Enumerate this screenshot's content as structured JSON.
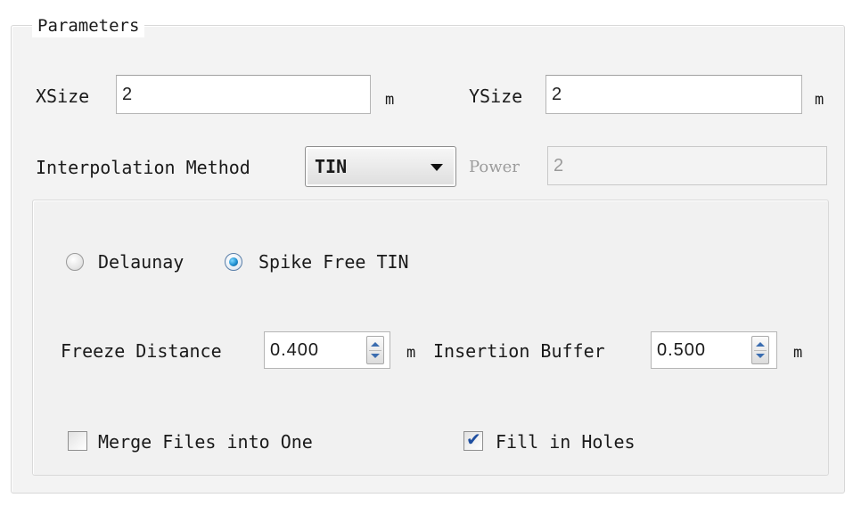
{
  "group": {
    "title": "Parameters"
  },
  "xsize": {
    "label": "XSize",
    "value": "2",
    "unit": "m"
  },
  "ysize": {
    "label": "YSize",
    "value": "2",
    "unit": "m"
  },
  "interpolation": {
    "label": "Interpolation Method",
    "selected": "TIN"
  },
  "power": {
    "label": "Power",
    "value": "2",
    "enabled": false
  },
  "tin_mode": {
    "options": [
      {
        "label": "Delaunay",
        "selected": false
      },
      {
        "label": "Spike Free TIN",
        "selected": true
      }
    ]
  },
  "freeze_distance": {
    "label": "Freeze Distance",
    "value": "0.400",
    "unit": "m"
  },
  "insertion_buffer": {
    "label": "Insertion Buffer",
    "value": "0.500",
    "unit": "m"
  },
  "merge_files": {
    "label": "Merge Files into One",
    "checked": false
  },
  "fill_holes": {
    "label": "Fill in Holes",
    "checked": true
  },
  "colors": {
    "radio_accent": "#1f8fd0",
    "check_accent": "#1f4fa0"
  },
  "icons": {
    "combo_arrow": "chevron-down-icon",
    "spin": "spin-arrows-icon",
    "tick": "checkmark-icon"
  }
}
